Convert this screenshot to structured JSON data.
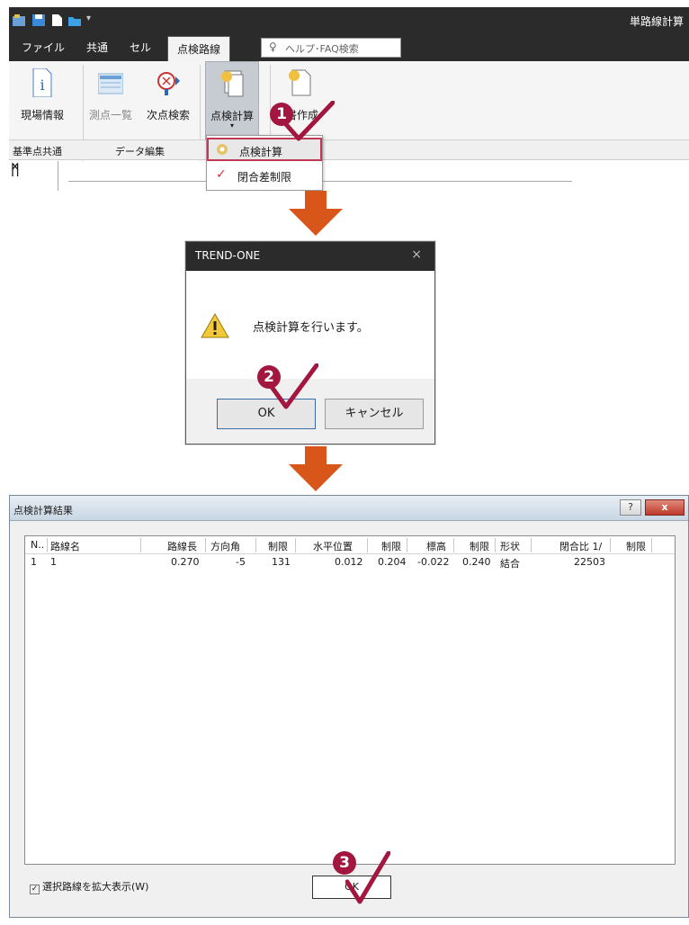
{
  "ribbon": {
    "app_title": "単路線計算",
    "tabs": [
      "ファイル",
      "共通",
      "セル",
      "点検路線"
    ],
    "search_placeholder": "ヘルプ･FAQ検索",
    "buttons": [
      "現場情報",
      "測点一覧",
      "次点検索",
      "点検計算",
      "帳票作成"
    ],
    "button_partial_visible": "書作成",
    "groups": [
      "基準点共通",
      "データ編集"
    ],
    "dropdown": [
      "点検計算",
      "閉合差制限"
    ]
  },
  "dialog": {
    "title": "TREND-ONE",
    "message": "点検計算を行います。",
    "ok": "OK",
    "cancel": "キャンセル"
  },
  "result": {
    "title": "点検計算結果",
    "help": "?",
    "close": "x",
    "columns": [
      "N..",
      "路線名",
      "路線長",
      "方向角",
      "制限",
      "水平位置",
      "制限",
      "標高",
      "制限",
      "形状",
      "閉合比 1/",
      "制限"
    ],
    "rows": [
      [
        "1",
        "1",
        "0.270",
        "-5",
        "131",
        "0.012",
        "0.204",
        "-0.022",
        "0.240",
        "結合",
        "22503",
        ""
      ]
    ],
    "checkbox_label": "選択路線を拡大表示(W)",
    "ok": "OK"
  },
  "badges": [
    "1",
    "2",
    "3"
  ],
  "colors": {
    "accent": "#a2163f",
    "arrow": "#d9561a",
    "titlebar": "#2b2b2b"
  }
}
